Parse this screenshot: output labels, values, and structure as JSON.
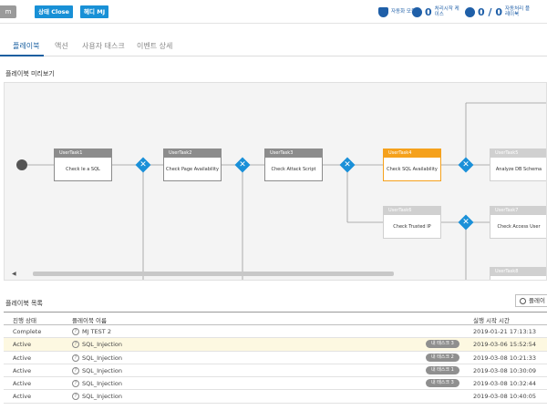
{
  "topbar": {
    "select_label": "m",
    "state_button": "상태 Close",
    "marker_button": "헤디 MJ",
    "stats": [
      {
        "icon": "shield-icon",
        "value": "",
        "label": "자동화 모듈"
      },
      {
        "icon": "check-circle-icon",
        "value": "0",
        "label": "처리시작 케이스"
      },
      {
        "icon": "count-circle-icon",
        "value": "0 / 0",
        "label": "자동처리 플레이북"
      }
    ]
  },
  "tabs": [
    {
      "label": "플레이북",
      "active": true
    },
    {
      "label": "액션",
      "active": false
    },
    {
      "label": "사용자 태스크",
      "active": false
    },
    {
      "label": "이벤트 상세",
      "active": false
    }
  ],
  "preview_title": "플레이북 미리보기",
  "tasks": [
    {
      "title": "UserTask1",
      "body": "Check Ie a SQL"
    },
    {
      "title": "UserTask2",
      "body": "Check Page Availability"
    },
    {
      "title": "UserTask3",
      "body": "Check Attack Script"
    },
    {
      "title": "UserTask4",
      "body": "Check SQL Availability"
    },
    {
      "title": "UserTask5",
      "body": "Analyze DB Schema"
    },
    {
      "title": "UserTask6",
      "body": "Check Trusted IP"
    },
    {
      "title": "UserTask7",
      "body": "Check Access User"
    },
    {
      "title": "UserTask8",
      "body": ""
    }
  ],
  "list_title": "플레이북 목록",
  "list_button": "플레이",
  "table": {
    "headers": [
      "진행 상태",
      "플레이북 이름",
      "실행 시작 시간"
    ],
    "rows": [
      {
        "status": "Complete",
        "name": "MJ TEST 2",
        "badge": "",
        "time": "2019-01-21 17:13:13"
      },
      {
        "status": "Active",
        "name": "SQL_Injection",
        "badge": "내 태스크 3",
        "time": "2019-03-06 15:52:54"
      },
      {
        "status": "Active",
        "name": "SQL_Injection",
        "badge": "내 태스크 2",
        "time": "2019-03-08 10:21:33"
      },
      {
        "status": "Active",
        "name": "SQL_Injection",
        "badge": "내 태스크 1",
        "time": "2019-03-08 10:30:09"
      },
      {
        "status": "Active",
        "name": "SQL_Injection",
        "badge": "내 태스크 3",
        "time": "2019-03-08 10:32:44"
      },
      {
        "status": "Active",
        "name": "SQL_Injection",
        "badge": "",
        "time": "2019-03-08 10:40:05"
      }
    ]
  },
  "colors": {
    "accent": "#1890d6",
    "active_task": "#f5a11c",
    "brand_dark": "#1f5fa8"
  }
}
